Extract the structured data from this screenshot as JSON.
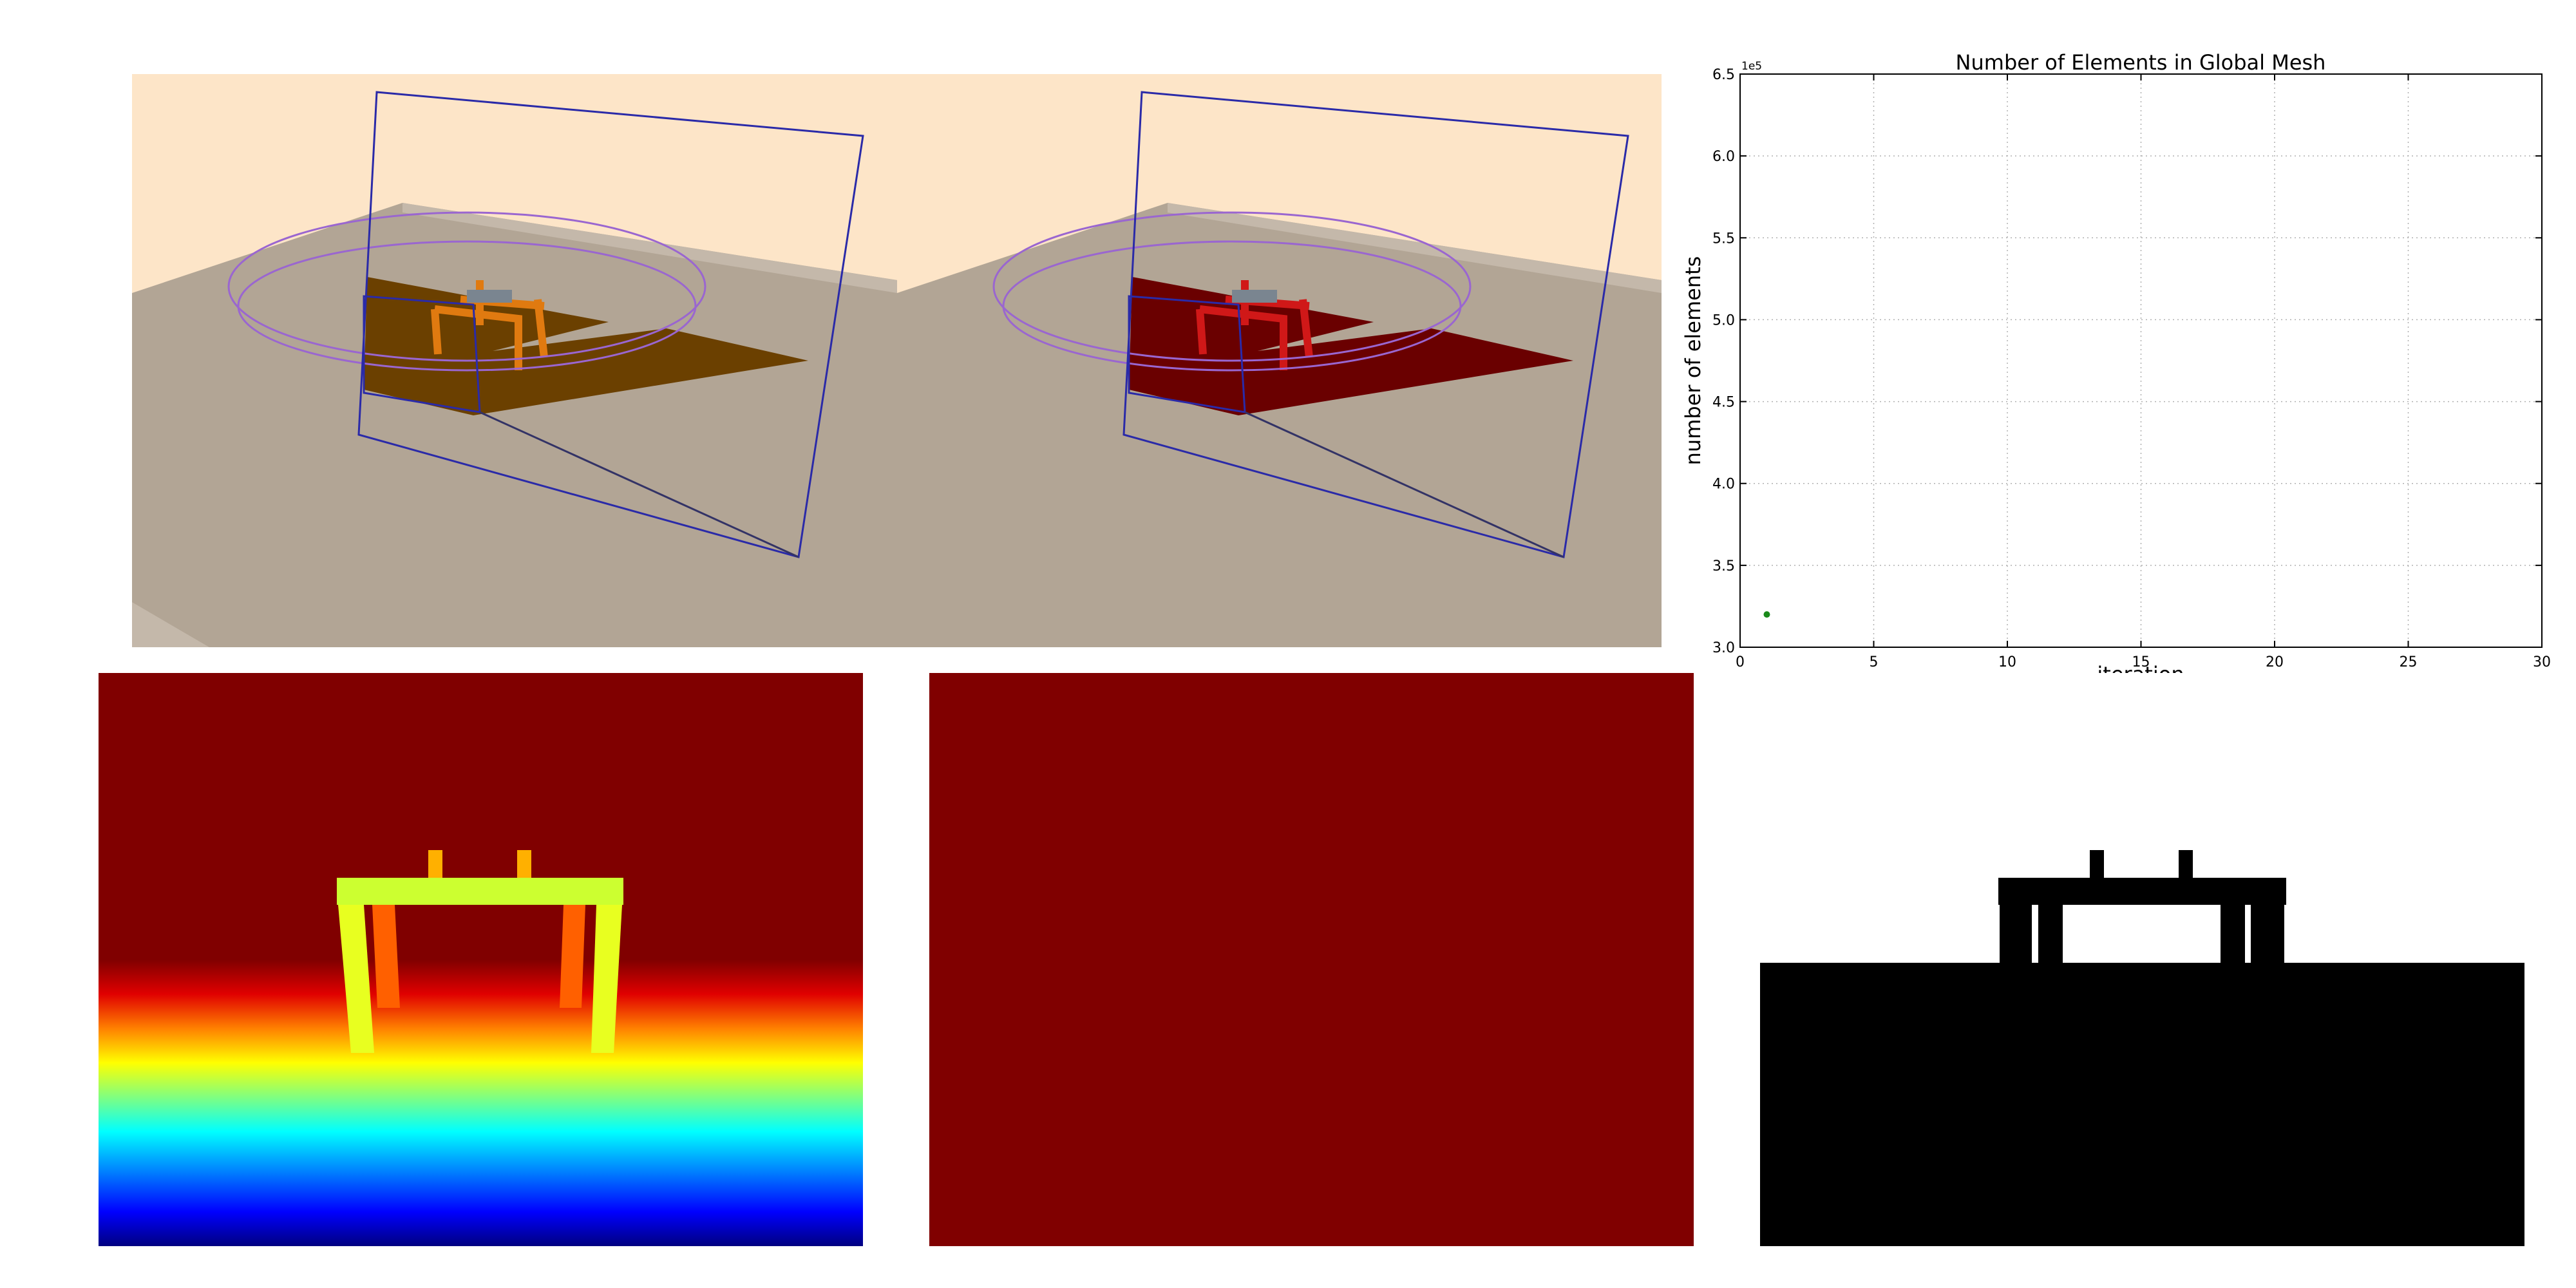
{
  "colors": {
    "scene_background": "#fde5c8",
    "ground": "#b2a595",
    "frustum": "#2a2aa8",
    "camera_path": "#9a66d0",
    "object_orange": "#e07a10",
    "object_red": "#d01818",
    "shadow_orange": "#6b4000",
    "shadow_red": "#6a0000",
    "depth_far": "#800000",
    "mask": "#000000",
    "marker": "#1a8a1a"
  },
  "chart_data": {
    "type": "scatter",
    "title": "Number of Elements in Global Mesh",
    "xlabel": "iteration",
    "ylabel": "number of elements",
    "y_multiplier_label": "1e5",
    "xlim": [
      0,
      30
    ],
    "ylim": [
      3.0,
      6.5
    ],
    "x_ticks": [
      0,
      5,
      10,
      15,
      20,
      25,
      30
    ],
    "x_tick_labels": [
      "0",
      "5",
      "10",
      "15",
      "20",
      "25",
      "30"
    ],
    "y_ticks": [
      3.0,
      3.5,
      4.0,
      4.5,
      5.0,
      5.5,
      6.0,
      6.5
    ],
    "y_tick_labels": [
      "3.0",
      "3.5",
      "4.0",
      "4.5",
      "5.0",
      "5.5",
      "6.0",
      "6.5"
    ],
    "grid": true,
    "series": [
      {
        "x": [
          1
        ],
        "y": [
          3.2
        ],
        "color": "#1a8a1a"
      }
    ]
  }
}
